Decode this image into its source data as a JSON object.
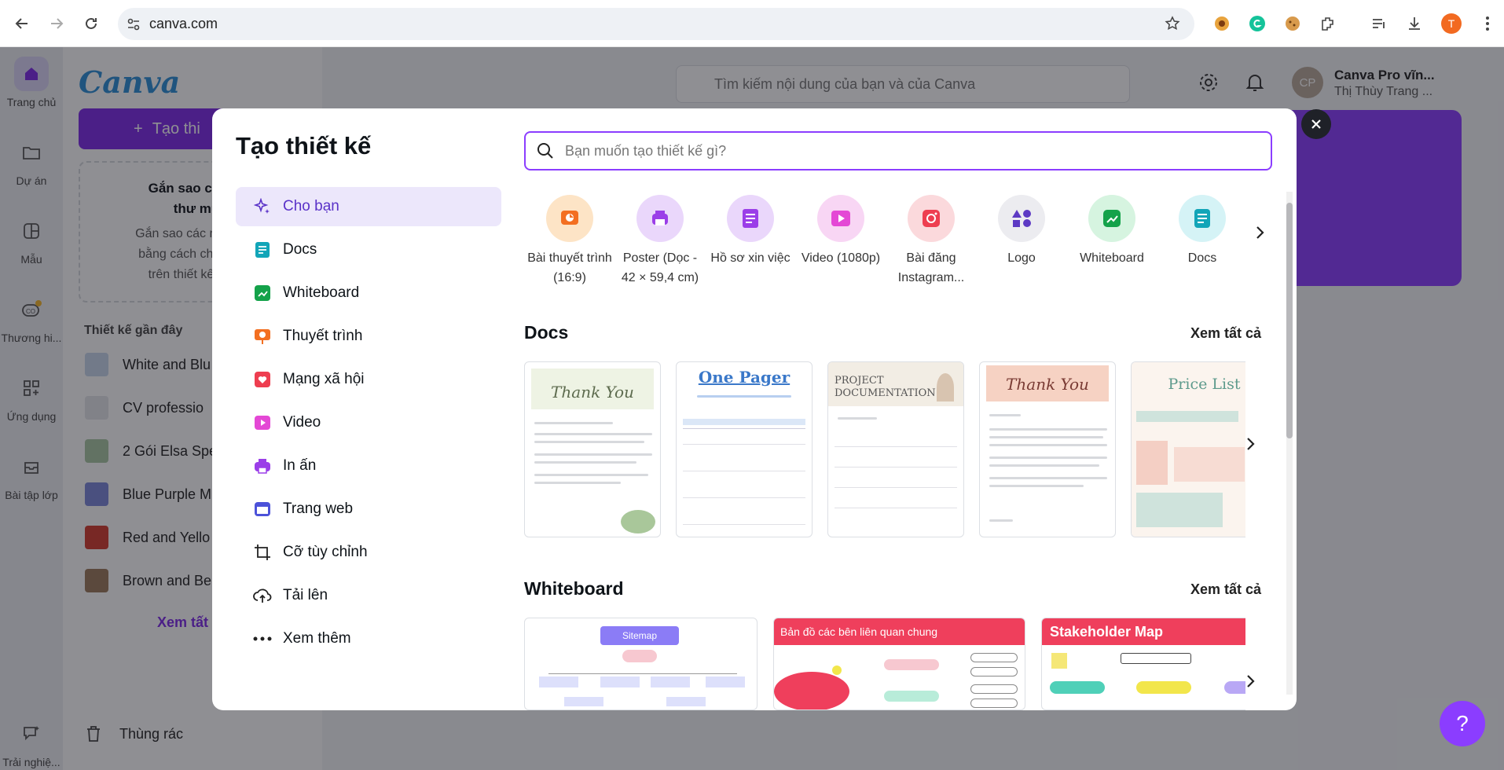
{
  "browser": {
    "url": "canva.com",
    "profile_initial": "T"
  },
  "rail": [
    {
      "label": "Trang chủ",
      "icon": "home-icon"
    },
    {
      "label": "Dự án",
      "icon": "folder-icon"
    },
    {
      "label": "Mẫu",
      "icon": "template-icon"
    },
    {
      "label": "Thương hi...",
      "icon": "brand-icon"
    },
    {
      "label": "Ứng dụng",
      "icon": "apps-icon"
    },
    {
      "label": "Bài tập lớp",
      "icon": "classwork-icon"
    },
    {
      "label": "Trải nghiệ...",
      "icon": "sparkle-icon"
    }
  ],
  "sidebar": {
    "logo": "Canva",
    "create_label": "Tạo thi",
    "star_title": "Gắn sao cho th\nthư mụ",
    "star_body": "Gắn sao các mục quả\nbằng cách chọn biểu\ntrên thiết kế hoặc",
    "recent_title": "Thiết kế gần đây",
    "recent": [
      "White and Blu",
      "CV professio",
      "2 Gói Elsa Spe",
      "Blue Purple M",
      "Red and Yello",
      "Brown and Be"
    ],
    "see_all": "Xem tất",
    "trash": "Thùng rác"
  },
  "header": {
    "search_placeholder": "Tìm kiếm nội dung của bạn và của Canva",
    "account_name": "Canva Pro vĩn...",
    "account_user": "Thị Thùy Trang ...",
    "avatar_initials": "CP"
  },
  "modal": {
    "title": "Tạo thiết kế",
    "search_placeholder": "Bạn muốn tạo thiết kế gì?",
    "categories": [
      {
        "label": "Cho bạn",
        "icon": "sparkle-icon"
      },
      {
        "label": "Docs",
        "icon": "docs-icon"
      },
      {
        "label": "Whiteboard",
        "icon": "whiteboard-icon"
      },
      {
        "label": "Thuyết trình",
        "icon": "presentation-icon"
      },
      {
        "label": "Mạng xã hội",
        "icon": "heart-icon"
      },
      {
        "label": "Video",
        "icon": "video-icon"
      },
      {
        "label": "In ấn",
        "icon": "print-icon"
      },
      {
        "label": "Trang web",
        "icon": "website-icon"
      },
      {
        "label": "Cỡ tùy chỉnh",
        "icon": "custom-size-icon"
      },
      {
        "label": "Tải lên",
        "icon": "upload-icon"
      },
      {
        "label": "Xem thêm",
        "icon": "more-icon"
      }
    ],
    "quick_actions": [
      {
        "label": "Bài thuyết trình (16:9)",
        "icon": "presentation-icon",
        "bg": "#fde4c6",
        "fg": "#f36f21"
      },
      {
        "label": "Poster (Dọc - 42 × 59,4 cm)",
        "icon": "poster-icon",
        "bg": "#ead7fb",
        "fg": "#9b3ee8"
      },
      {
        "label": "Hồ sơ xin việc",
        "icon": "resume-icon",
        "bg": "#ead7fb",
        "fg": "#9b3ee8"
      },
      {
        "label": "Video (1080p)",
        "icon": "video-icon",
        "bg": "#f8d6f4",
        "fg": "#e448d5"
      },
      {
        "label": "Bài đăng Instagram...",
        "icon": "instagram-icon",
        "bg": "#fbd9dc",
        "fg": "#ee3e50"
      },
      {
        "label": "Logo",
        "icon": "logo-icon",
        "bg": "#ececf0",
        "fg": "#5d3ac4"
      },
      {
        "label": "Whiteboard",
        "icon": "whiteboard-icon",
        "bg": "#d6f4e0",
        "fg": "#14a24a"
      },
      {
        "label": "Docs",
        "icon": "docs-icon",
        "bg": "#d5f3f6",
        "fg": "#12a5b8"
      }
    ],
    "docs_section": {
      "title": "Docs",
      "see_all": "Xem tất cả",
      "templates": [
        {
          "title": "Thank You",
          "accent": "#8aa88a"
        },
        {
          "title": "One Pager",
          "accent": "#3a78c9"
        },
        {
          "title": "PROJECT DOCUMENTATION",
          "accent": "#5a5a5a"
        },
        {
          "title": "Thank You",
          "accent": "#c9665d"
        },
        {
          "title": "Price List",
          "accent": "#5d9a8c"
        }
      ]
    },
    "whiteboard_section": {
      "title": "Whiteboard",
      "see_all": "Xem tất cả",
      "templates": [
        {
          "title": "Sitemap",
          "accent": "#8b7cf6"
        },
        {
          "title": "Bản đồ các bên liên quan chung",
          "accent": "#ef3f5c"
        },
        {
          "title": "Stakeholder Map",
          "accent": "#ef3f5c"
        }
      ]
    }
  },
  "help_label": "?"
}
